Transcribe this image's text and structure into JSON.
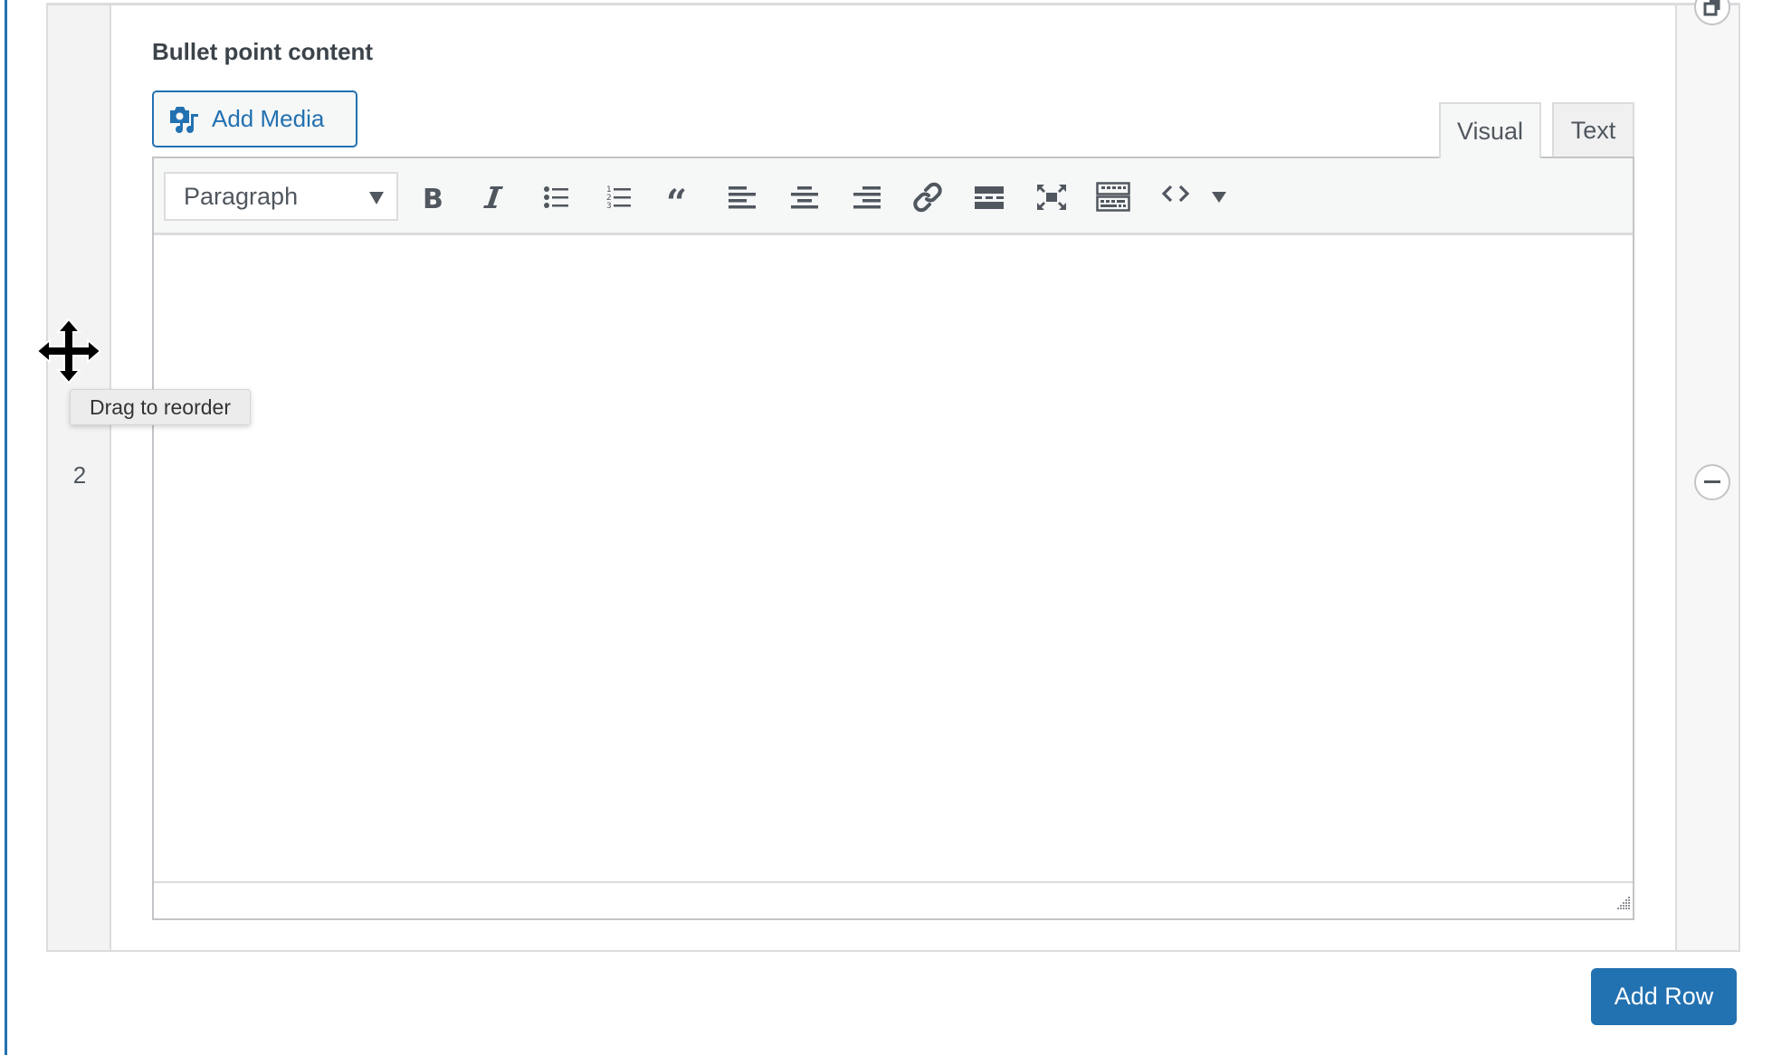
{
  "field": {
    "label": "Bullet point content"
  },
  "row": {
    "number": "2"
  },
  "editor": {
    "add_media_label": "Add Media",
    "tabs": [
      {
        "label": "Visual",
        "active": true
      },
      {
        "label": "Text",
        "active": false
      }
    ],
    "format_select": {
      "value": "Paragraph"
    },
    "toolbar_buttons": [
      {
        "name": "bold",
        "icon": "bold-icon"
      },
      {
        "name": "italic",
        "icon": "italic-icon"
      },
      {
        "name": "bulleted-list",
        "icon": "bulleted-list-icon"
      },
      {
        "name": "numbered-list",
        "icon": "numbered-list-icon"
      },
      {
        "name": "blockquote",
        "icon": "blockquote-icon"
      },
      {
        "name": "align-left",
        "icon": "align-left-icon"
      },
      {
        "name": "align-center",
        "icon": "align-center-icon"
      },
      {
        "name": "align-right",
        "icon": "align-right-icon"
      },
      {
        "name": "insert-link",
        "icon": "link-icon"
      },
      {
        "name": "read-more",
        "icon": "read-more-icon"
      },
      {
        "name": "fullscreen",
        "icon": "fullscreen-icon"
      },
      {
        "name": "toolbar-toggle",
        "icon": "keyboard-icon"
      },
      {
        "name": "code",
        "icon": "code-icon"
      },
      {
        "name": "more-dropdown",
        "icon": "caret-down-icon"
      }
    ],
    "content": ""
  },
  "tooltip": {
    "text": "Drag to reorder"
  },
  "buttons": {
    "add_row": "Add Row"
  },
  "colors": {
    "accent": "#2271b1",
    "icon": "#50575e",
    "border": "#dcdcde"
  }
}
